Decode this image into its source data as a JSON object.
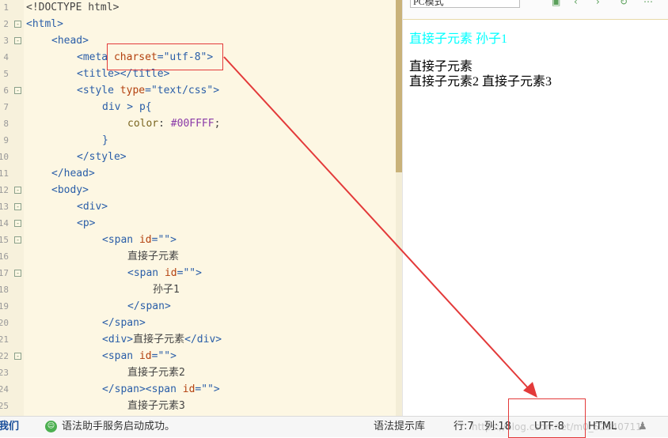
{
  "editor": {
    "lines": [
      {
        "n": "1",
        "fold": "",
        "indent": 0,
        "parts": [
          {
            "t": "<!DOCTYPE html>",
            "c": "txt"
          }
        ]
      },
      {
        "n": "2",
        "fold": "-",
        "indent": 0,
        "parts": [
          {
            "t": "<html>",
            "c": "tag"
          }
        ]
      },
      {
        "n": "3",
        "fold": "-",
        "indent": 1,
        "parts": [
          {
            "t": "<head>",
            "c": "tag"
          }
        ]
      },
      {
        "n": "4",
        "fold": "",
        "indent": 2,
        "parts": [
          {
            "t": "<meta ",
            "c": "tag"
          },
          {
            "t": "charset",
            "c": "attr"
          },
          {
            "t": "=",
            "c": "tag"
          },
          {
            "t": "\"utf-8\"",
            "c": "str"
          },
          {
            "t": ">",
            "c": "tag"
          }
        ]
      },
      {
        "n": "5",
        "fold": "",
        "indent": 2,
        "parts": [
          {
            "t": "<title></title>",
            "c": "tag"
          }
        ]
      },
      {
        "n": "6",
        "fold": "-",
        "indent": 2,
        "parts": [
          {
            "t": "<style ",
            "c": "tag"
          },
          {
            "t": "type",
            "c": "attr"
          },
          {
            "t": "=",
            "c": "tag"
          },
          {
            "t": "\"text/css\"",
            "c": "str"
          },
          {
            "t": ">",
            "c": "tag"
          }
        ]
      },
      {
        "n": "7",
        "fold": "",
        "indent": 3,
        "parts": [
          {
            "t": "div > p{",
            "c": "tag"
          }
        ]
      },
      {
        "n": "8",
        "fold": "",
        "indent": 4,
        "parts": [
          {
            "t": "color",
            "c": "prop"
          },
          {
            "t": ": ",
            "c": "txt"
          },
          {
            "t": "#00FFFF",
            "c": "hex"
          },
          {
            "t": ";",
            "c": "txt"
          }
        ]
      },
      {
        "n": "9",
        "fold": "",
        "indent": 3,
        "parts": [
          {
            "t": "}",
            "c": "tag"
          }
        ]
      },
      {
        "n": "10",
        "fold": "",
        "indent": 2,
        "parts": [
          {
            "t": "</style>",
            "c": "tag"
          }
        ]
      },
      {
        "n": "11",
        "fold": "",
        "indent": 1,
        "parts": [
          {
            "t": "</head>",
            "c": "tag"
          }
        ]
      },
      {
        "n": "12",
        "fold": "-",
        "indent": 1,
        "parts": [
          {
            "t": "<body>",
            "c": "tag"
          }
        ]
      },
      {
        "n": "13",
        "fold": "-",
        "indent": 2,
        "parts": [
          {
            "t": "<div>",
            "c": "tag"
          }
        ]
      },
      {
        "n": "14",
        "fold": "-",
        "indent": 2,
        "parts": [
          {
            "t": "<p>",
            "c": "tag"
          }
        ]
      },
      {
        "n": "15",
        "fold": "-",
        "indent": 3,
        "parts": [
          {
            "t": "<span ",
            "c": "tag"
          },
          {
            "t": "id",
            "c": "attr"
          },
          {
            "t": "=",
            "c": "tag"
          },
          {
            "t": "\"\"",
            "c": "str"
          },
          {
            "t": ">",
            "c": "tag"
          }
        ]
      },
      {
        "n": "16",
        "fold": "",
        "indent": 4,
        "parts": [
          {
            "t": "直接子元素",
            "c": "txt"
          }
        ]
      },
      {
        "n": "17",
        "fold": "-",
        "indent": 4,
        "parts": [
          {
            "t": "<span ",
            "c": "tag"
          },
          {
            "t": "id",
            "c": "attr"
          },
          {
            "t": "=",
            "c": "tag"
          },
          {
            "t": "\"\"",
            "c": "str"
          },
          {
            "t": ">",
            "c": "tag"
          }
        ]
      },
      {
        "n": "18",
        "fold": "",
        "indent": 5,
        "parts": [
          {
            "t": "孙子1",
            "c": "txt"
          }
        ]
      },
      {
        "n": "19",
        "fold": "",
        "indent": 4,
        "parts": [
          {
            "t": "</span>",
            "c": "tag"
          }
        ]
      },
      {
        "n": "20",
        "fold": "",
        "indent": 3,
        "parts": [
          {
            "t": "</span>",
            "c": "tag"
          }
        ]
      },
      {
        "n": "21",
        "fold": "",
        "indent": 3,
        "parts": [
          {
            "t": "<div>",
            "c": "tag"
          },
          {
            "t": "直接子元素",
            "c": "txt"
          },
          {
            "t": "</div>",
            "c": "tag"
          }
        ]
      },
      {
        "n": "22",
        "fold": "-",
        "indent": 3,
        "parts": [
          {
            "t": "<span ",
            "c": "tag"
          },
          {
            "t": "id",
            "c": "attr"
          },
          {
            "t": "=",
            "c": "tag"
          },
          {
            "t": "\"\"",
            "c": "str"
          },
          {
            "t": ">",
            "c": "tag"
          }
        ]
      },
      {
        "n": "23",
        "fold": "",
        "indent": 4,
        "parts": [
          {
            "t": "直接子元素2",
            "c": "txt"
          }
        ]
      },
      {
        "n": "24",
        "fold": "",
        "indent": 3,
        "parts": [
          {
            "t": "</span>",
            "c": "tag"
          },
          {
            "t": "<span ",
            "c": "tag"
          },
          {
            "t": "id",
            "c": "attr"
          },
          {
            "t": "=",
            "c": "tag"
          },
          {
            "t": "\"\"",
            "c": "str"
          },
          {
            "t": ">",
            "c": "tag"
          }
        ]
      },
      {
        "n": "25",
        "fold": "",
        "indent": 4,
        "parts": [
          {
            "t": "直接子元素3",
            "c": "txt"
          }
        ]
      }
    ]
  },
  "preview": {
    "mode_label": "PC模式",
    "line1": "直接子元素 孙子1",
    "line2": "直接子元素",
    "line3": "直接子元素2 直接子元素3",
    "highlight_color": "#00FFFF"
  },
  "statusbar": {
    "left_cut_label": "我们",
    "service_message": "语法助手服务启动成功。",
    "hint_library": "语法提示库",
    "row_label": "行:7",
    "col_label": "列:18",
    "encoding": "UTF-8",
    "language": "HTML",
    "watermark": "https://blog.csdn.net/m0_52840711"
  },
  "colors": {
    "annotation_red": "#e33a3a",
    "editor_bg": "#fdf7e3",
    "tag_blue": "#2a5ea8",
    "attr_orange": "#b3410f"
  }
}
